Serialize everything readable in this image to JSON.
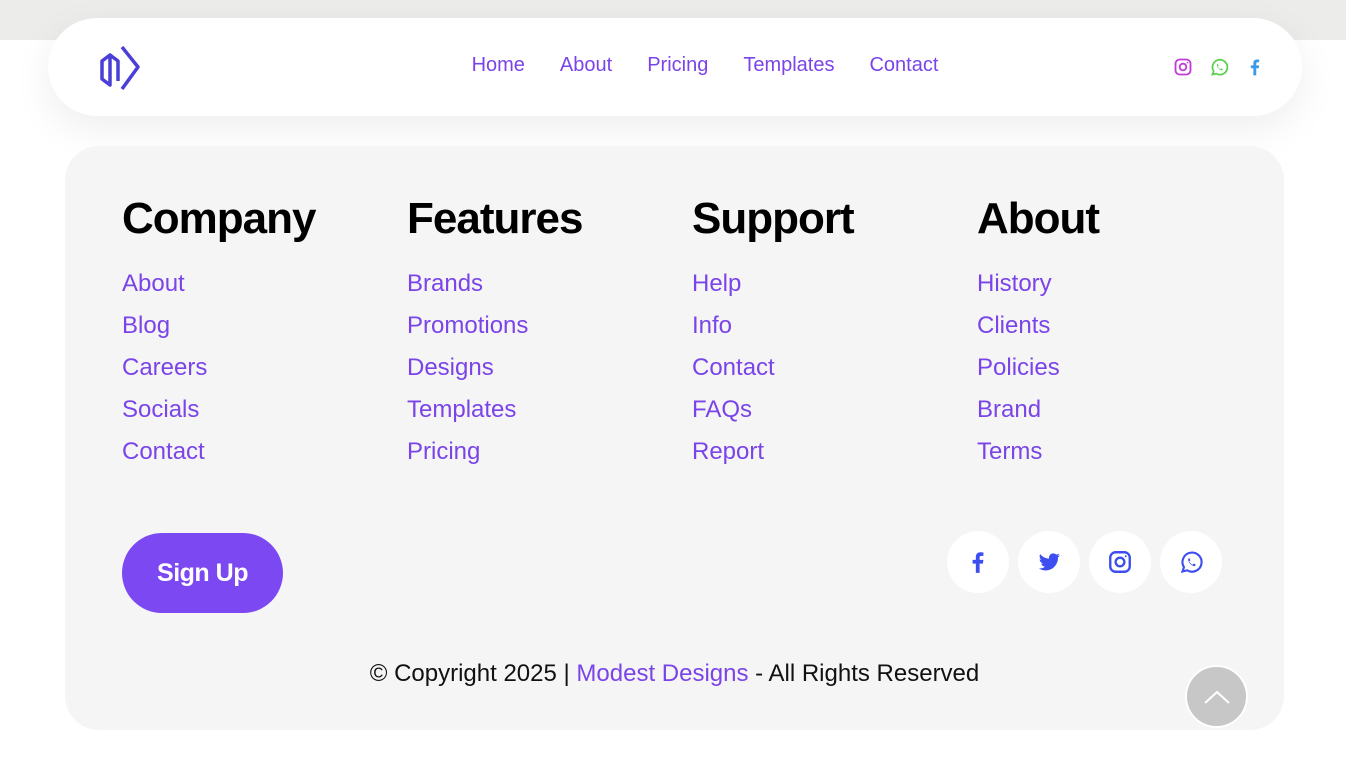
{
  "nav": {
    "links": [
      "Home",
      "About",
      "Pricing",
      "Templates",
      "Contact"
    ],
    "social_icons": [
      "instagram-icon",
      "whatsapp-icon",
      "facebook-icon"
    ]
  },
  "footer": {
    "columns": [
      {
        "title": "Company",
        "links": [
          "About",
          "Blog",
          "Careers",
          "Socials",
          "Contact"
        ]
      },
      {
        "title": "Features",
        "links": [
          "Brands",
          "Promotions",
          "Designs",
          "Templates",
          "Pricing"
        ]
      },
      {
        "title": "Support",
        "links": [
          "Help",
          "Info",
          "Contact",
          "FAQs",
          "Report"
        ]
      },
      {
        "title": "About",
        "links": [
          "History",
          "Clients",
          "Policies",
          "Brand",
          "Terms"
        ]
      }
    ],
    "signup_label": "Sign Up",
    "social_icons": [
      "facebook-icon",
      "twitter-icon",
      "instagram-icon",
      "whatsapp-icon"
    ],
    "copyright_prefix": "© Copyright 2025 | ",
    "copyright_brand": "Modest Designs",
    "copyright_suffix": " - All Rights Reserved"
  },
  "colors": {
    "accent": "#7a44e8",
    "button": "#7c48f2",
    "social_blue": "#3d4ef0",
    "footer_bg": "#f5f5f5"
  }
}
